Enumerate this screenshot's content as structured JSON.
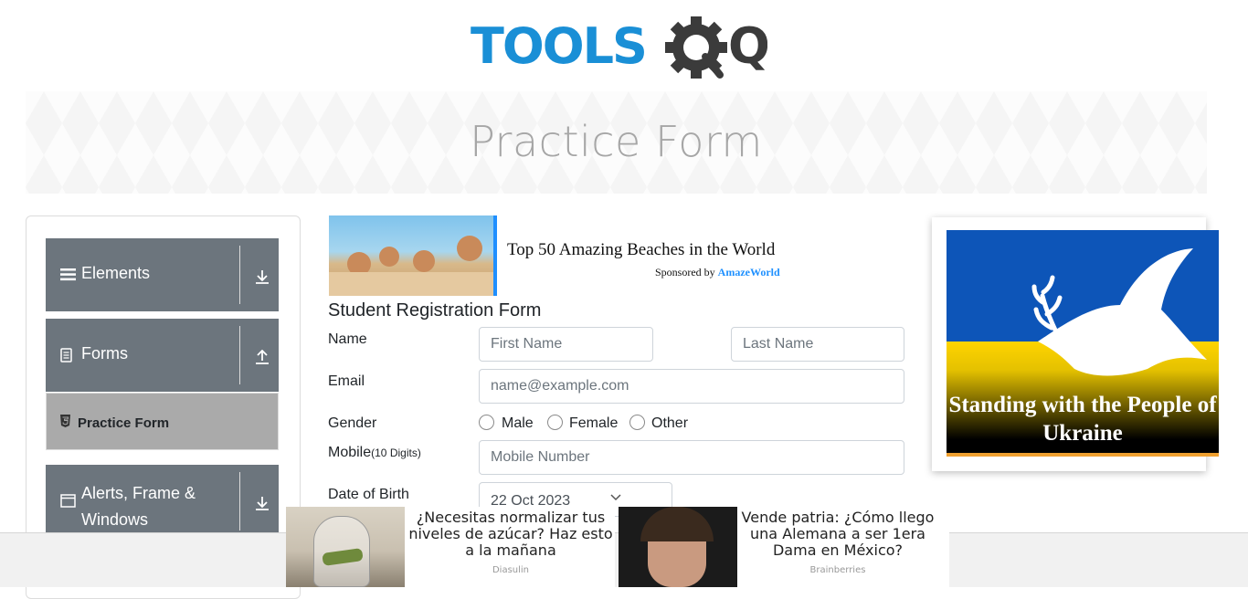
{
  "logo": {
    "text_a": "TOOLS",
    "text_b": "QA"
  },
  "banner": {
    "title": "Practice Form"
  },
  "sidebar": {
    "groups": [
      {
        "label": "Elements",
        "icon": "hamburger-icon",
        "arrow": "arrow-down-icon"
      },
      {
        "label": "Forms",
        "icon": "document-icon",
        "arrow": "arrow-up-icon"
      },
      {
        "label": "Alerts, Frame & Windows",
        "icon": "window-icon",
        "arrow": "arrow-down-icon"
      }
    ],
    "active_item": {
      "label": "Practice Form",
      "icon": "html5-icon"
    }
  },
  "ad_top": {
    "headline": "Top 50 Amazing Beaches in the World",
    "sponsor_prefix": "Sponsored by ",
    "sponsor_name": "AmazeWorld"
  },
  "form": {
    "title": "Student Registration Form",
    "name_label": "Name",
    "first_name_placeholder": "First Name",
    "last_name_placeholder": "Last Name",
    "email_label": "Email",
    "email_placeholder": "name@example.com",
    "gender_label": "Gender",
    "gender_options": [
      "Male",
      "Female",
      "Other"
    ],
    "mobile_label": "Mobile",
    "mobile_hint": "(10 Digits)",
    "mobile_placeholder": "Mobile Number",
    "dob_label": "Date of Birth",
    "dob_value": "22 Oct 2023"
  },
  "ukraine": {
    "text": "Standing with the People of Ukraine"
  },
  "footer_ads": [
    {
      "text": "¿Necesitas normalizar tus niveles de azúcar? Haz esto a la mañana",
      "source": "Diasulin"
    },
    {
      "text": "Vende patria: ¿Cómo llego una Alemana a ser 1era Dama en México?",
      "source": "Brainberries"
    }
  ],
  "colors": {
    "accent": "#1a8fd6",
    "logo_dark": "#3b3b3b",
    "sidebar_group": "#6c757d",
    "active_item": "#aaaaaa"
  }
}
